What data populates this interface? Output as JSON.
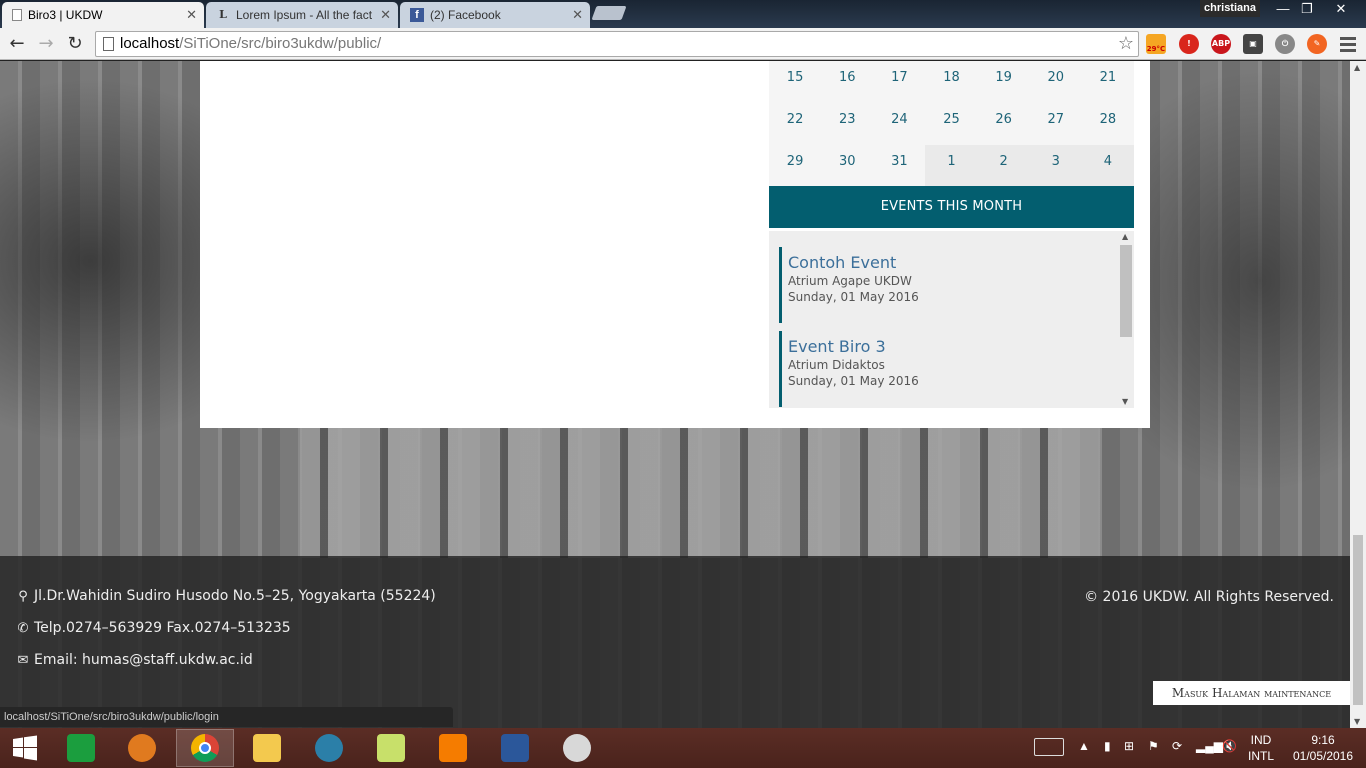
{
  "browser": {
    "tabs": [
      {
        "label": "Biro3 | UKDW",
        "active": true,
        "icon": "page-icon"
      },
      {
        "label": "Lorem Ipsum - All the fact",
        "active": false,
        "icon": "lipsum-icon"
      },
      {
        "label": "(2) Facebook",
        "active": false,
        "icon": "facebook-icon"
      }
    ],
    "user": "christiana",
    "url_host": "localhost",
    "url_path": "/SiTiOne/src/biro3ukdw/public/",
    "weather": "29°C",
    "ext_abp": "ABP",
    "status_url": "localhost/SiTiOne/src/biro3ukdw/public/login"
  },
  "calendar": {
    "weeks": [
      [
        {
          "d": "15"
        },
        {
          "d": "16"
        },
        {
          "d": "17"
        },
        {
          "d": "18"
        },
        {
          "d": "19"
        },
        {
          "d": "20"
        },
        {
          "d": "21"
        }
      ],
      [
        {
          "d": "22"
        },
        {
          "d": "23"
        },
        {
          "d": "24"
        },
        {
          "d": "25"
        },
        {
          "d": "26"
        },
        {
          "d": "27"
        },
        {
          "d": "28"
        }
      ],
      [
        {
          "d": "29"
        },
        {
          "d": "30"
        },
        {
          "d": "31"
        },
        {
          "d": "1",
          "next": true
        },
        {
          "d": "2",
          "next": true
        },
        {
          "d": "3",
          "next": true
        },
        {
          "d": "4",
          "next": true
        }
      ]
    ]
  },
  "events": {
    "header": "EVENTS THIS MONTH",
    "items": [
      {
        "title": "Contoh Event",
        "location": "Atrium Agape UKDW",
        "date": "Sunday, 01 May 2016"
      },
      {
        "title": "Event Biro 3",
        "location": "Atrium Didaktos",
        "date": "Sunday, 01 May 2016"
      }
    ]
  },
  "footer": {
    "address": "Jl.Dr.Wahidin Sudiro Husodo No.5–25, Yogyakarta (55224)",
    "phone": "Telp.0274–563929 Fax.0274–513235",
    "email": "Email: humas@staff.ukdw.ac.id",
    "copyright": "© 2016 UKDW. All Rights Reserved.",
    "maintenance_button": "Masuk Halaman maintenance"
  },
  "taskbar": {
    "lang_1": "IND",
    "lang_2": "INTL",
    "time": "9:16",
    "date": "01/05/2016"
  },
  "colors": {
    "accent": "#035e6f",
    "event_title": "#3b6f9a",
    "calendar_text": "#1e6478"
  }
}
